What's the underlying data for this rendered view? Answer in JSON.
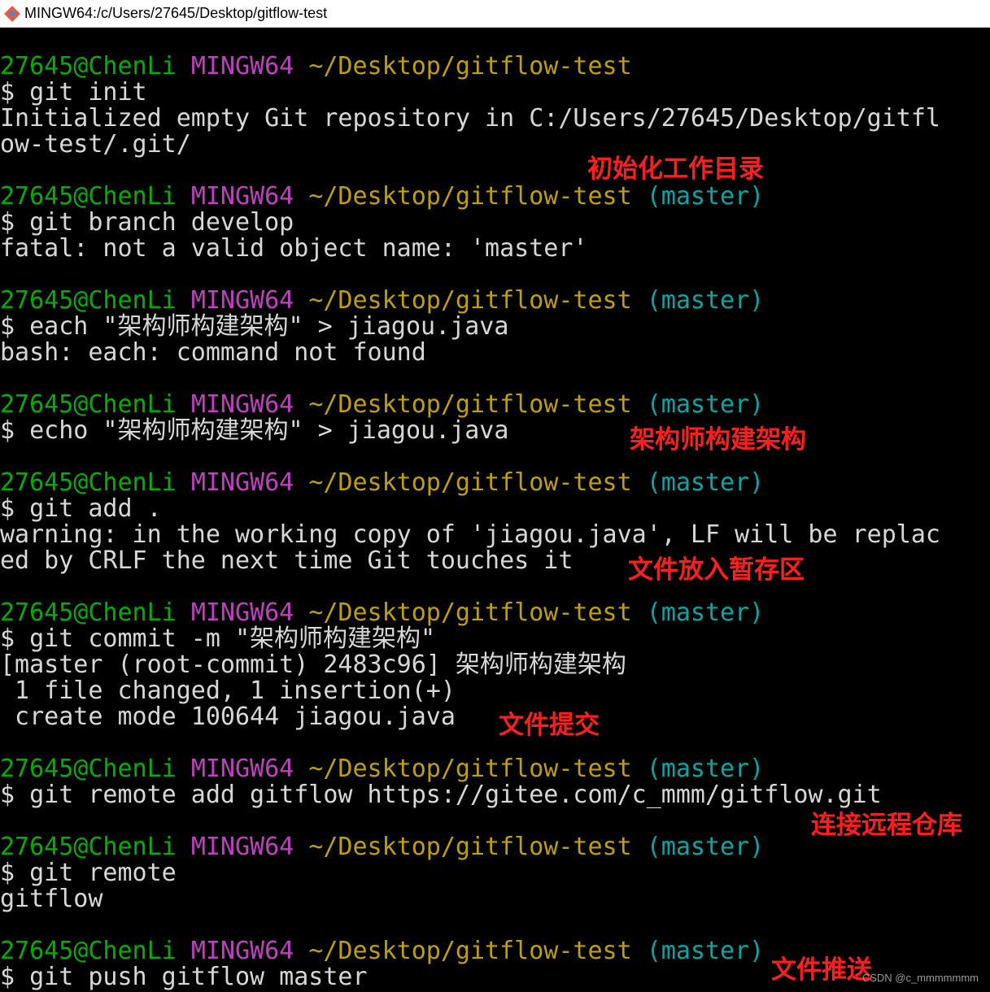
{
  "window": {
    "title": "MINGW64:/c/Users/27645/Desktop/gitflow-test",
    "icon": "git-bash-icon"
  },
  "colors": {
    "user": "#00b000",
    "host": "#c040c0",
    "path": "#c0a000",
    "branch": "#00a8a8",
    "text": "#d7d7d7",
    "annotation": "#ff1e1e"
  },
  "prompt": {
    "user": "27645@ChenLi",
    "host": "MINGW64",
    "path": "~/Desktop/gitflow-test",
    "branch": "(master)"
  },
  "blocks": [
    {
      "command": "$ git init",
      "output": [
        "Initialized empty Git repository in C:/Users/27645/Desktop/gitfl",
        "ow-test/.git/"
      ],
      "has_branch": false
    },
    {
      "command": "$ git branch develop",
      "output": [
        "fatal: not a valid object name: 'master'"
      ],
      "has_branch": true
    },
    {
      "command": "$ each \"架构师构建架构\" > jiagou.java",
      "output": [
        "bash: each: command not found"
      ],
      "has_branch": true
    },
    {
      "command": "$ echo \"架构师构建架构\" > jiagou.java",
      "output": [],
      "has_branch": true
    },
    {
      "command": "$ git add .",
      "output": [
        "warning: in the working copy of 'jiagou.java', LF will be replac",
        "ed by CRLF the next time Git touches it"
      ],
      "has_branch": true
    },
    {
      "command": "$ git commit -m \"架构师构建架构\"",
      "output": [
        "[master (root-commit) 2483c96] 架构师构建架构",
        " 1 file changed, 1 insertion(+)",
        " create mode 100644 jiagou.java"
      ],
      "has_branch": true
    },
    {
      "command": "$ git remote add gitflow https://gitee.com/c_mmm/gitflow.git",
      "output": [],
      "has_branch": true
    },
    {
      "command": "$ git remote",
      "output": [
        "gitflow"
      ],
      "has_branch": true
    },
    {
      "command": "$ git push gitflow master",
      "output": [],
      "has_branch": true
    }
  ],
  "annotations": {
    "init": "初始化工作目录",
    "echo": "架构师构建架构",
    "add": "文件放入暂存区",
    "commit": "文件提交",
    "remote": "连接远程仓库",
    "push": "文件推送"
  },
  "watermark": "CSDN @c_mmmmmmm"
}
